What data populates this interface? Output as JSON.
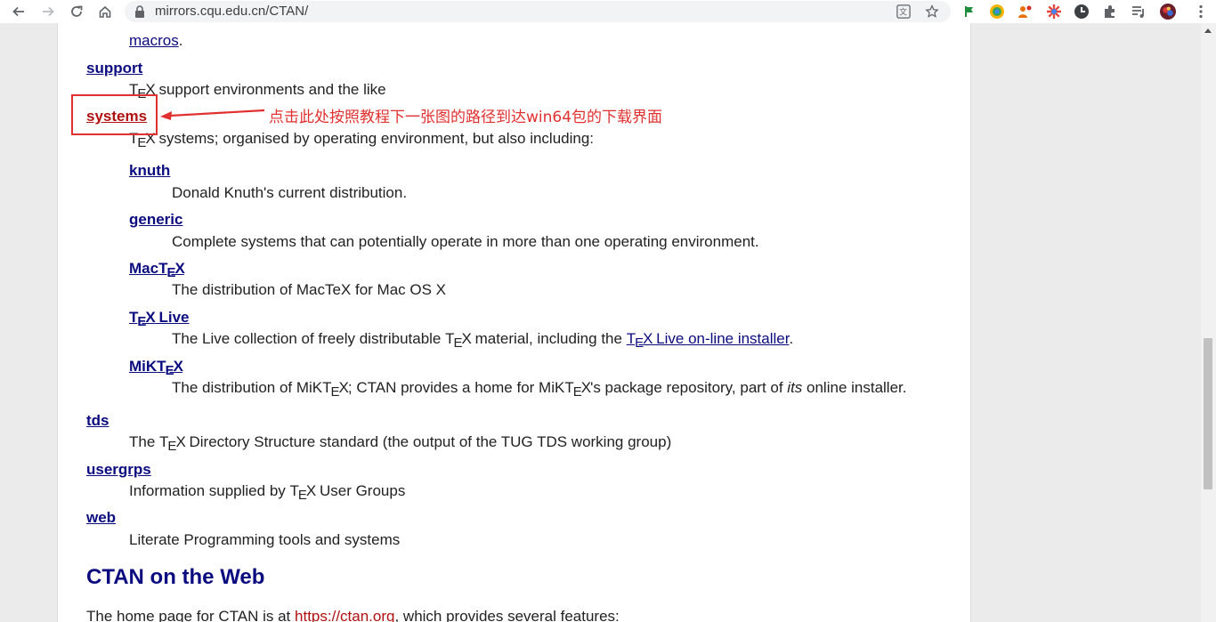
{
  "browser": {
    "url": "mirrors.cqu.edu.cn/CTAN/"
  },
  "content": {
    "top_fragment": "macros",
    "entries": [
      {
        "title": "support",
        "desc_rest": " support environments and the like"
      },
      {
        "title": "systems",
        "desc_rest": " systems; organised by operating environment, but also including:"
      },
      {
        "title": "knuth",
        "desc": "Donald Knuth's current distribution."
      },
      {
        "title": "generic",
        "desc": "Complete systems that can potentially operate in more than one operating environment."
      },
      {
        "title": "MacTeX",
        "desc": "The distribution of MacTeX for Mac OS X"
      },
      {
        "title": "TeX Live",
        "desc_prefix": "The Live collection of freely distributable ",
        "desc_mid": " material, including the ",
        "desc_link": " Live on-line installer",
        "desc_suffix": "."
      },
      {
        "title": "MiKTeX",
        "desc_prefix": "The distribution of MiK",
        "desc_mid": "; CTAN provides a home for MiK",
        "desc_mid2": "'s package repository, part of ",
        "desc_italic": "its",
        "desc_suffix": " online installer."
      },
      {
        "title": "tds",
        "desc_prefix": "The ",
        "desc_rest": " Directory Structure standard (the output of the TUG TDS working group)"
      },
      {
        "title": "usergrps",
        "desc_prefix": "Information supplied by ",
        "desc_rest": " User Groups"
      },
      {
        "title": "web",
        "desc": "Literate Programming tools and systems"
      }
    ],
    "section_heading": "CTAN on the Web",
    "footer_prefix": "The home page for CTAN is at ",
    "footer_link": "https://ctan.org",
    "footer_suffix": ", which provides several features:"
  },
  "annotation": {
    "text": "点击此处按照教程下一张图的路径到达win64包的下载界面",
    "color": "#e03030"
  },
  "colors": {
    "link": "#0b0b80",
    "annotation": "#e03030"
  }
}
